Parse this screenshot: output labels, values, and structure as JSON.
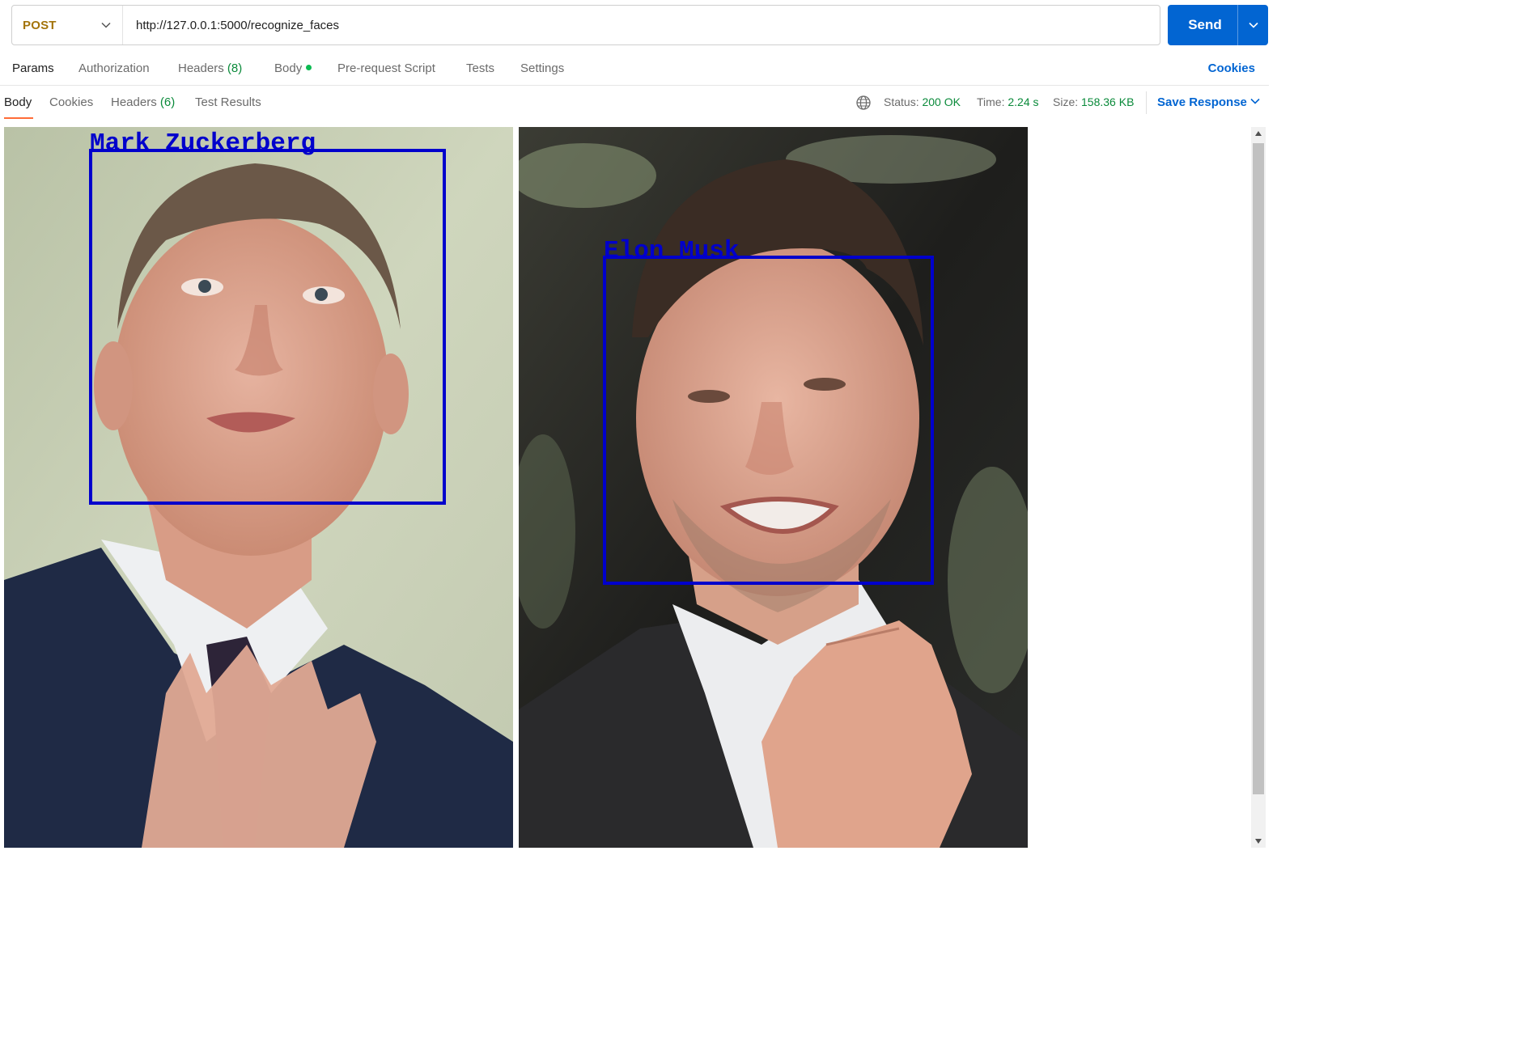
{
  "request": {
    "method": "POST",
    "url": "http://127.0.0.1:5000/recognize_faces",
    "send_label": "Send"
  },
  "request_tabs": {
    "params": "Params",
    "authorization": "Authorization",
    "headers": "Headers",
    "headers_count": "(8)",
    "body": "Body",
    "pre_request_script": "Pre-request Script",
    "tests": "Tests",
    "settings": "Settings",
    "cookies": "Cookies"
  },
  "response_tabs": {
    "body": "Body",
    "cookies": "Cookies",
    "headers": "Headers",
    "headers_count": "(6)",
    "test_results": "Test Results"
  },
  "response_meta": {
    "status_label": "Status:",
    "status_value": "200 OK",
    "time_label": "Time:",
    "time_value": "2.24 s",
    "size_label": "Size:",
    "size_value": "158.36 KB",
    "save_response": "Save Response"
  },
  "response_images": [
    {
      "face_label": "Mark Zuckerberg"
    },
    {
      "face_label": "Elon Musk"
    }
  ],
  "colors": {
    "accent_blue": "#0265d2",
    "method_color": "#a3740b",
    "status_green": "#0a8a3a",
    "active_tab_underline": "#ff6c37",
    "face_box": "#0000cc"
  },
  "icons": {
    "method_dropdown": "chevron-down-icon",
    "send_dropdown": "chevron-down-icon",
    "network": "globe-icon",
    "save_dropdown": "chevron-down-icon"
  }
}
